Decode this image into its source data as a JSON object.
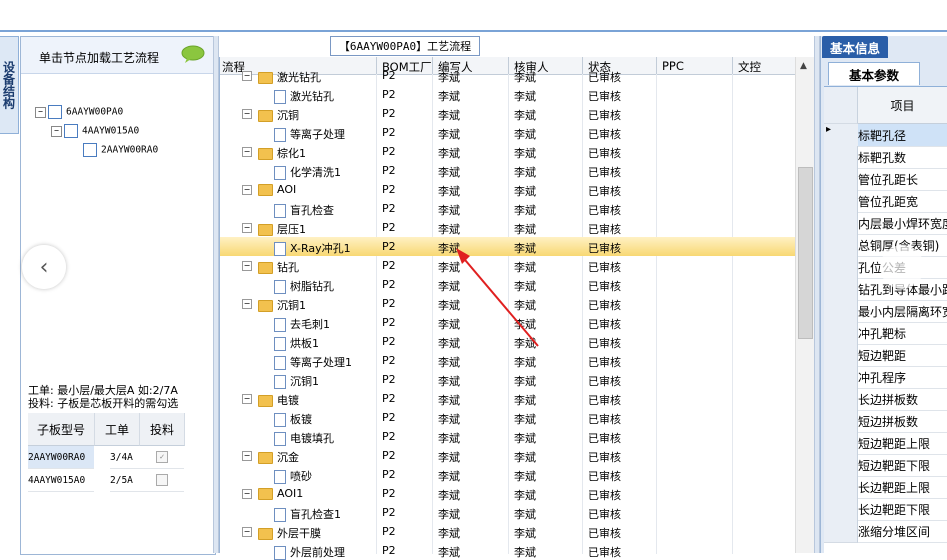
{
  "left_panel": {
    "vertical_tab": "设备结构",
    "load_hint": "单击节点加载工艺流程",
    "tree": [
      {
        "label": "6AAYW00PA0",
        "expand": "−"
      },
      {
        "label": "4AAYW015A0",
        "expand": "−"
      },
      {
        "label": "2AAYW00RA0",
        "expand": ""
      }
    ],
    "note_line1": "工单: 最小层/最大层A 如:2/7A",
    "note_line2": "投料: 子板是芯板开料的需勾选",
    "subgrid": {
      "headers": [
        "子板型号",
        "工单",
        "投料"
      ],
      "rows": [
        {
          "model": "2AAYW00RA0",
          "order": "3/4A",
          "feed": "✓"
        },
        {
          "model": "4AAYW015A0",
          "order": "2/5A",
          "feed": ""
        }
      ]
    }
  },
  "center_panel": {
    "title": "【6AAYW00PA0】工艺流程",
    "columns": [
      "流程",
      "BOM工厂",
      "编写人",
      "核审人",
      "状态",
      "PPC",
      "文控"
    ],
    "rows": [
      {
        "name": "激光钻孔",
        "level": 0,
        "bom": "P2",
        "writer": "李斌",
        "checker": "李斌",
        "status": "已审核",
        "partial": true
      },
      {
        "name": "激光钻孔",
        "level": 1,
        "bom": "P2",
        "writer": "李斌",
        "checker": "李斌",
        "status": "已审核"
      },
      {
        "name": "沉铜",
        "level": 0,
        "bom": "P2",
        "writer": "李斌",
        "checker": "李斌",
        "status": "已审核"
      },
      {
        "name": "等离子处理",
        "level": 1,
        "bom": "P2",
        "writer": "李斌",
        "checker": "李斌",
        "status": "已审核"
      },
      {
        "name": "棕化1",
        "level": 0,
        "bom": "P2",
        "writer": "李斌",
        "checker": "李斌",
        "status": "已审核"
      },
      {
        "name": "化学清洗1",
        "level": 1,
        "bom": "P2",
        "writer": "李斌",
        "checker": "李斌",
        "status": "已审核"
      },
      {
        "name": "AOI",
        "level": 0,
        "bom": "P2",
        "writer": "李斌",
        "checker": "李斌",
        "status": "已审核"
      },
      {
        "name": "盲孔检查",
        "level": 1,
        "bom": "P2",
        "writer": "李斌",
        "checker": "李斌",
        "status": "已审核"
      },
      {
        "name": "层压1",
        "level": 0,
        "bom": "P2",
        "writer": "李斌",
        "checker": "李斌",
        "status": "已审核"
      },
      {
        "name": "X-Ray冲孔1",
        "level": 1,
        "bom": "P2",
        "writer": "李斌",
        "checker": "李斌",
        "status": "已审核",
        "selected": true
      },
      {
        "name": "钻孔",
        "level": 0,
        "bom": "P2",
        "writer": "李斌",
        "checker": "李斌",
        "status": "已审核"
      },
      {
        "name": "树脂钻孔",
        "level": 1,
        "bom": "P2",
        "writer": "李斌",
        "checker": "李斌",
        "status": "已审核"
      },
      {
        "name": "沉铜1",
        "level": 0,
        "bom": "P2",
        "writer": "李斌",
        "checker": "李斌",
        "status": "已审核"
      },
      {
        "name": "去毛刺1",
        "level": 1,
        "bom": "P2",
        "writer": "李斌",
        "checker": "李斌",
        "status": "已审核"
      },
      {
        "name": "烘板1",
        "level": 1,
        "bom": "P2",
        "writer": "李斌",
        "checker": "李斌",
        "status": "已审核"
      },
      {
        "name": "等离子处理1",
        "level": 1,
        "bom": "P2",
        "writer": "李斌",
        "checker": "李斌",
        "status": "已审核"
      },
      {
        "name": "沉铜1",
        "level": 1,
        "bom": "P2",
        "writer": "李斌",
        "checker": "李斌",
        "status": "已审核"
      },
      {
        "name": "电镀",
        "level": 0,
        "bom": "P2",
        "writer": "李斌",
        "checker": "李斌",
        "status": "已审核"
      },
      {
        "name": "板镀",
        "level": 1,
        "bom": "P2",
        "writer": "李斌",
        "checker": "李斌",
        "status": "已审核"
      },
      {
        "name": "电镀填孔",
        "level": 1,
        "bom": "P2",
        "writer": "李斌",
        "checker": "李斌",
        "status": "已审核"
      },
      {
        "name": "沉金",
        "level": 0,
        "bom": "P2",
        "writer": "李斌",
        "checker": "李斌",
        "status": "已审核"
      },
      {
        "name": "喷砂",
        "level": 1,
        "bom": "P2",
        "writer": "李斌",
        "checker": "李斌",
        "status": "已审核"
      },
      {
        "name": "AOI1",
        "level": 0,
        "bom": "P2",
        "writer": "李斌",
        "checker": "李斌",
        "status": "已审核"
      },
      {
        "name": "盲孔检查1",
        "level": 1,
        "bom": "P2",
        "writer": "李斌",
        "checker": "李斌",
        "status": "已审核"
      },
      {
        "name": "外层干膜",
        "level": 0,
        "bom": "P2",
        "writer": "李斌",
        "checker": "李斌",
        "status": "已审核"
      },
      {
        "name": "外层前处理",
        "level": 1,
        "bom": "P2",
        "writer": "李斌",
        "checker": "李斌",
        "status": "已审核"
      }
    ]
  },
  "right_panel": {
    "tab": "基本信息",
    "sub_tab": "基本参数",
    "column_header": "项目",
    "items": [
      "标靶孔径",
      "标靶孔数",
      "管位孔距长",
      "管位孔距宽",
      "内层最小焊环宽度",
      "总铜厚(含表铜)",
      "孔位公差",
      "钻孔到导体最小距离",
      "最小内层隔离环宽",
      "冲孔靶标",
      "短边靶距",
      "冲孔程序",
      "长边拼板数",
      "短边拼板数",
      "短边靶距上限",
      "短边靶距下限",
      "长边靶距上限",
      "长边靶距下限",
      "涨缩分堆区间"
    ]
  },
  "colors": {
    "accent": "#2a5ea8",
    "selected_row": "#f8d873",
    "annotation_arrow": "#e02020"
  }
}
